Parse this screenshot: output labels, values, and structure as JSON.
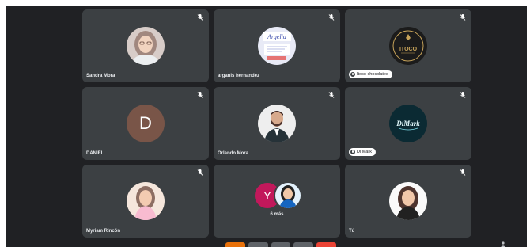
{
  "participants": [
    {
      "name": "Sandra Mora",
      "avatar": "photo",
      "muted": true
    },
    {
      "name": "arganis hernandez",
      "avatar": "logo",
      "logo_text": "Argelia",
      "muted": true
    },
    {
      "name": "Itoco chocolates",
      "avatar": "logo",
      "logo_text": "ITOCO",
      "presentation_pill": true,
      "muted": true
    },
    {
      "name": "DANIEL",
      "avatar": "letter",
      "initial": "D",
      "avatar_color": "#795548",
      "muted": true
    },
    {
      "name": "Orlando Mora",
      "avatar": "photo",
      "muted": true
    },
    {
      "name": "Di Mark",
      "avatar": "logo",
      "logo_text": "DiMark",
      "presentation_pill": true,
      "muted": true
    },
    {
      "name": "Myriam Rincón",
      "avatar": "photo",
      "muted": true
    },
    {
      "more_count_label": "6 más",
      "stack_initial": "Y",
      "stack_color": "#c2185b"
    },
    {
      "name": "Tú",
      "avatar": "photo",
      "muted": true
    }
  ],
  "icons": {
    "mic_muted": "microphone-off-icon",
    "pill": "pin-icon"
  },
  "colors": {
    "background": "#202124",
    "tile": "#3c4043",
    "text": "#e8eaed"
  }
}
